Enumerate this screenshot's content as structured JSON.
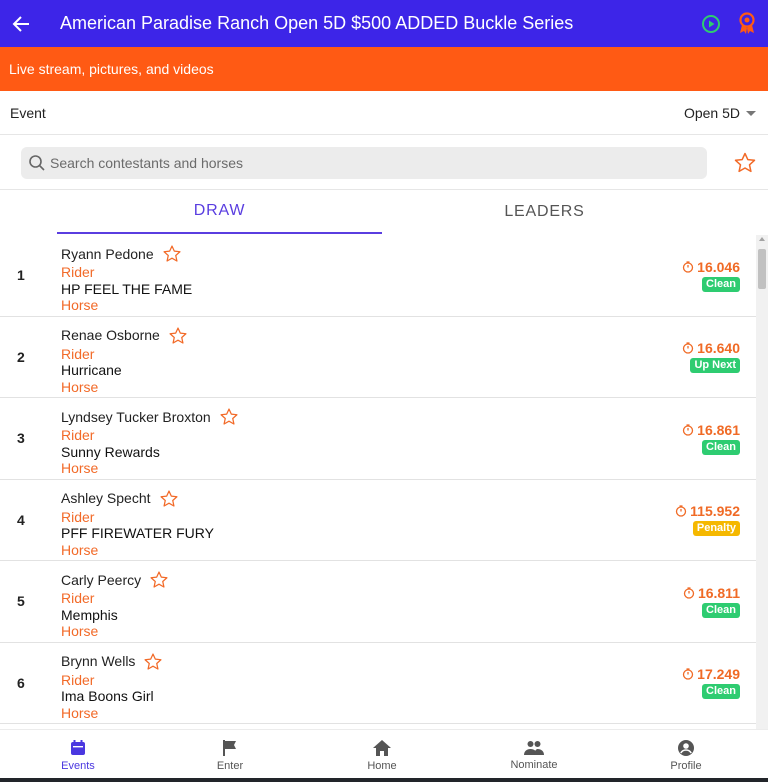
{
  "app_bar": {
    "title": "American Paradise Ranch Open 5D $500 ADDED Buckle Series",
    "back_icon": "arrow-left-icon",
    "actions": [
      "play-circle-icon",
      "award-ribbon-icon"
    ]
  },
  "banner": {
    "text": "Live stream, pictures, and videos"
  },
  "event_filter": {
    "label": "Event",
    "selected": "Open 5D"
  },
  "search": {
    "placeholder": "Search contestants and horses"
  },
  "tabs": [
    {
      "label": "DRAW",
      "active": true
    },
    {
      "label": "LEADERS",
      "active": false
    }
  ],
  "contestants": [
    {
      "position": "1",
      "rider": "Ryann Pedone",
      "rider_role": "Rider",
      "horse": "HP FEEL THE FAME",
      "horse_role": "Horse",
      "time": "16.046",
      "status": "Clean"
    },
    {
      "position": "2",
      "rider": "Renae Osborne",
      "rider_role": "Rider",
      "horse": "Hurricane",
      "horse_role": "Horse",
      "time": "16.640",
      "status": "Up Next"
    },
    {
      "position": "3",
      "rider": "Lyndsey Tucker Broxton",
      "rider_role": "Rider",
      "horse": "Sunny Rewards",
      "horse_role": "Horse",
      "time": "16.861",
      "status": "Clean"
    },
    {
      "position": "4",
      "rider": "Ashley Specht",
      "rider_role": "Rider",
      "horse": "PFF FIREWATER FURY",
      "horse_role": "Horse",
      "time": "115.952",
      "status": "Penalty"
    },
    {
      "position": "5",
      "rider": "Carly Peercy",
      "rider_role": "Rider",
      "horse": "Memphis",
      "horse_role": "Horse",
      "time": "16.811",
      "status": "Clean"
    },
    {
      "position": "6",
      "rider": "Brynn Wells",
      "rider_role": "Rider",
      "horse": "Ima Boons Girl",
      "horse_role": "Horse",
      "time": "17.249",
      "status": "Clean"
    }
  ],
  "status_colors": {
    "Clean": "#2ecc71",
    "Up Next": "#2ecc71",
    "Penalty": "#f5b800"
  },
  "colors": {
    "app_bar": "#3d25e8",
    "banner": "#ff5a14",
    "accent": "#f06a25",
    "tab_active": "#5a3ee0"
  },
  "bottom_nav": [
    {
      "label": "Events",
      "icon": "calendar-icon",
      "active": true
    },
    {
      "label": "Enter",
      "icon": "flag-icon",
      "active": false
    },
    {
      "label": "Home",
      "icon": "home-icon",
      "active": false
    },
    {
      "label": "Nominate",
      "icon": "people-icon",
      "active": false
    },
    {
      "label": "Profile",
      "icon": "account-circle-icon",
      "active": false
    }
  ]
}
